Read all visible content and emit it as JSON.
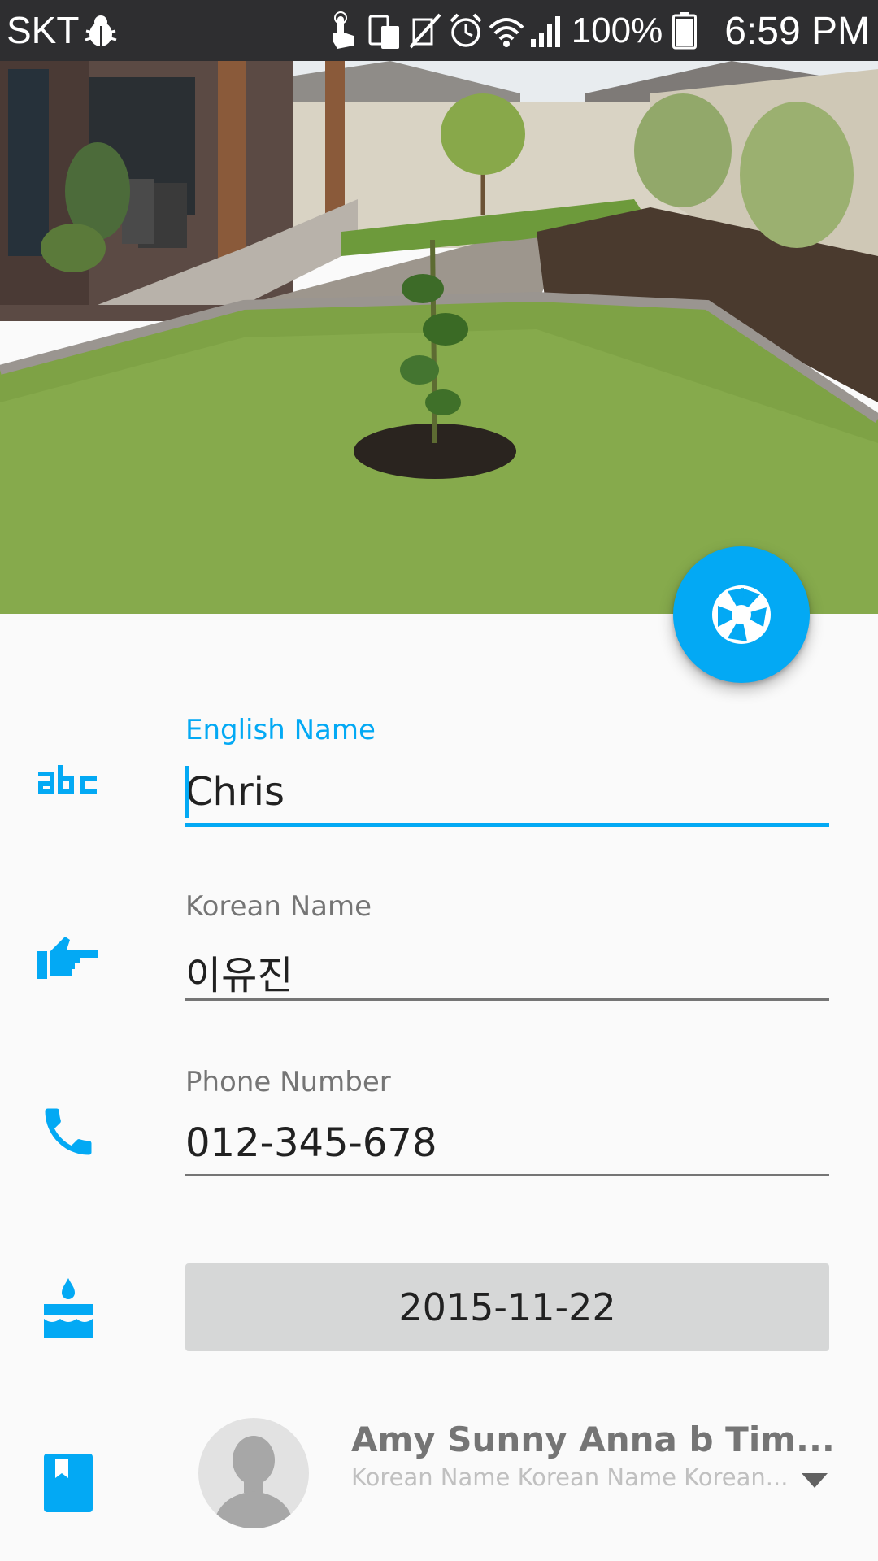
{
  "status_bar": {
    "carrier": "SKT",
    "battery": "100%",
    "time": "6:59 PM",
    "icons": [
      "debug-bug-icon",
      "touch-icon",
      "screen-rotate-icon",
      "vibrate-off-icon",
      "alarm-icon",
      "wifi-icon",
      "signal-icon",
      "battery-icon"
    ]
  },
  "header": {
    "photo": "garden-photo"
  },
  "fab": {
    "icon": "camera-shutter-icon"
  },
  "form": {
    "english_name": {
      "label": "English Name",
      "value": "Chris",
      "icon": "abc-icon"
    },
    "korean_name": {
      "label": "Korean Name",
      "value": "이유진",
      "icon": "thumb-point-icon"
    },
    "phone": {
      "label": "Phone Number",
      "value": "012-345-678",
      "icon": "phone-icon"
    },
    "birthday": {
      "value": "2015-11-22",
      "icon": "cake-icon"
    },
    "contact": {
      "icon": "bookmark-book-icon",
      "name": "Amy Sunny Anna b Tim...",
      "subtitle": "Korean Name Korean Name Korean..."
    }
  },
  "colors": {
    "accent": "#03a9f4",
    "status_bar": "#2e2e30",
    "background": "#fafafa",
    "date_button": "#d6d7d7"
  }
}
